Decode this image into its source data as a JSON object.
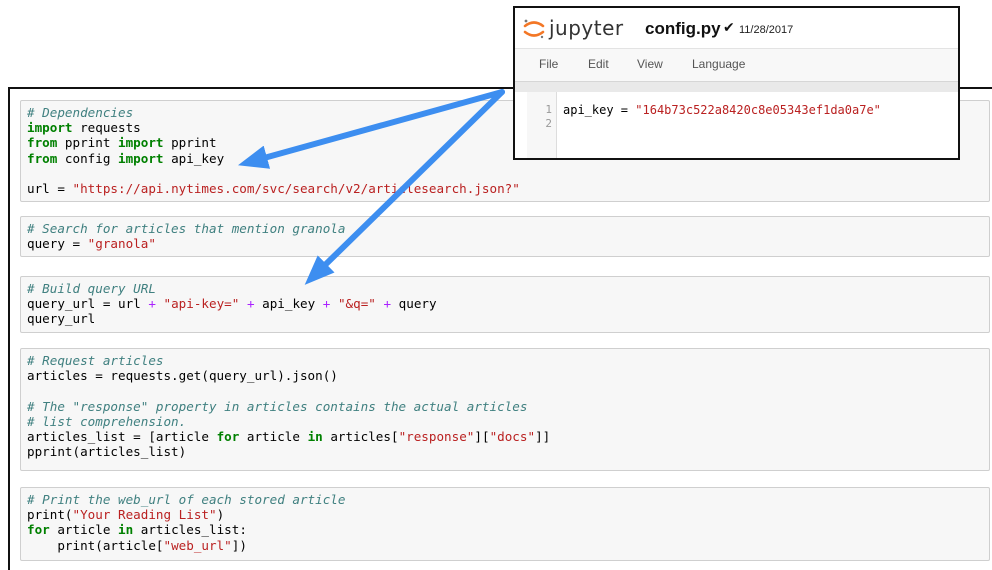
{
  "jupyter": {
    "brand": "jupyter",
    "filename": "config.py",
    "check": "✔",
    "date": "11/28/2017",
    "menu": [
      "File",
      "Edit",
      "View",
      "Language"
    ],
    "line_numbers": [
      "1",
      "2"
    ],
    "code_parts": [
      "api_key",
      " = ",
      "\"164b73c522a8420c8e05343ef1da0a7e\""
    ]
  },
  "cells": {
    "c1": {
      "l1": "# Dependencies",
      "l2": [
        "import",
        " requests"
      ],
      "l3": [
        "from",
        " pprint ",
        "import",
        " pprint"
      ],
      "l4": [
        "from",
        " config ",
        "import",
        " api_key"
      ],
      "l6": [
        "url = ",
        "\"https://api.nytimes.com/svc/search/v2/articlesearch.json?\""
      ]
    },
    "c2": {
      "l1": "# Search for articles that mention granola",
      "l2": [
        "query = ",
        "\"granola\""
      ]
    },
    "c3": {
      "l1": "# Build query URL",
      "l2": [
        "query_url = url ",
        "+",
        " ",
        "\"api-key=\"",
        " ",
        "+",
        " api_key ",
        "+",
        " ",
        "\"&q=\"",
        " ",
        "+",
        " query"
      ],
      "l3": "query_url"
    },
    "c4": {
      "l1": "# Request articles",
      "l2": "articles = requests.get(query_url).json()",
      "l4": "# The \"response\" property in articles contains the actual articles",
      "l5": "# list comprehension.",
      "l6": [
        "articles_list = [article ",
        "for",
        " article ",
        "in",
        " articles[",
        "\"response\"",
        "][",
        "\"docs\"",
        "]]"
      ],
      "l7": "pprint(articles_list)"
    },
    "c5": {
      "l1": "# Print the web_url of each stored article",
      "l2": [
        "print(",
        "\"Your Reading List\"",
        ")"
      ],
      "l3": [
        "for",
        " article ",
        "in",
        " articles_list:"
      ],
      "l4": [
        "    print(article[",
        "\"web_url\"",
        "])"
      ]
    }
  },
  "colors": {
    "arrow": "#3d8ef0",
    "comment": "#408080",
    "keyword": "#008000",
    "string": "#ba2121",
    "operator": "#aa22ff",
    "jupyter_logo": "#f37726"
  }
}
